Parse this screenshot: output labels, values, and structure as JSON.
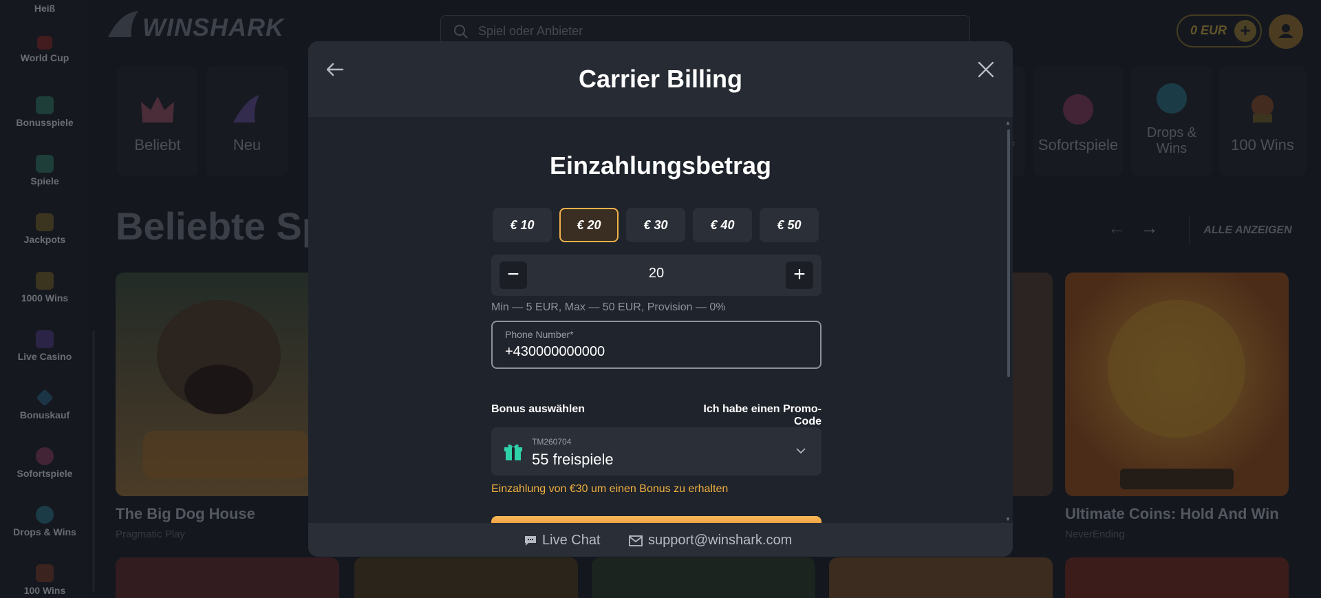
{
  "sidebar": {
    "items": [
      {
        "label": "Heiß"
      },
      {
        "label": "World Cup"
      },
      {
        "label": "Bonusspiele"
      },
      {
        "label": "Spiele"
      },
      {
        "label": "Jackpots"
      },
      {
        "label": "1000 Wins"
      },
      {
        "label": "Live Casino"
      },
      {
        "label": "Bonuskauf"
      },
      {
        "label": "Sofortspiele"
      },
      {
        "label": "Drops & Wins"
      },
      {
        "label": "100 Wins"
      }
    ]
  },
  "header": {
    "logo": "WINSHARK",
    "search_placeholder": "Spiel oder Anbieter",
    "balance": "0 EUR"
  },
  "categories": [
    {
      "label": "Beliebt"
    },
    {
      "label": "Neu"
    },
    {
      "label": "f"
    },
    {
      "label": "Sofortspiele"
    },
    {
      "label": "Drops & Wins"
    },
    {
      "label": "100 Wins"
    }
  ],
  "section": {
    "title": "Beliebte Sp",
    "all_label": "ALLE ANZEIGEN"
  },
  "games": [
    {
      "title": "The Big Dog House",
      "provider": "Pragmatic Play"
    },
    {
      "title": "Ultimate Coins: Hold And Win",
      "provider": "NeverEnding"
    }
  ],
  "modal": {
    "title": "Carrier Billing",
    "section_title": "Einzahlungsbetrag",
    "amounts": [
      "€ 10",
      "€ 20",
      "€ 30",
      "€ 40",
      "€ 50"
    ],
    "selected_amount_index": 1,
    "amount_value": "20",
    "limits": "Min — 5 EUR, Max — 50 EUR, Provision — 0%",
    "phone_label": "Phone Number*",
    "phone_value": "+430000000000",
    "bonus_label": "Bonus auswählen",
    "promo_label": "Ich habe einen Promo-Code",
    "bonus_code": "TM260704",
    "bonus_name": "55 freispiele",
    "bonus_note": "Einzahlung von €30 um einen Bonus zu erhalten",
    "footer": {
      "chat": "Live Chat",
      "email": "support@winshark.com"
    }
  },
  "colors": {
    "accent": "#f2b24a",
    "bonus_note": "#f0b040",
    "modal_bg": "#1f232b"
  }
}
